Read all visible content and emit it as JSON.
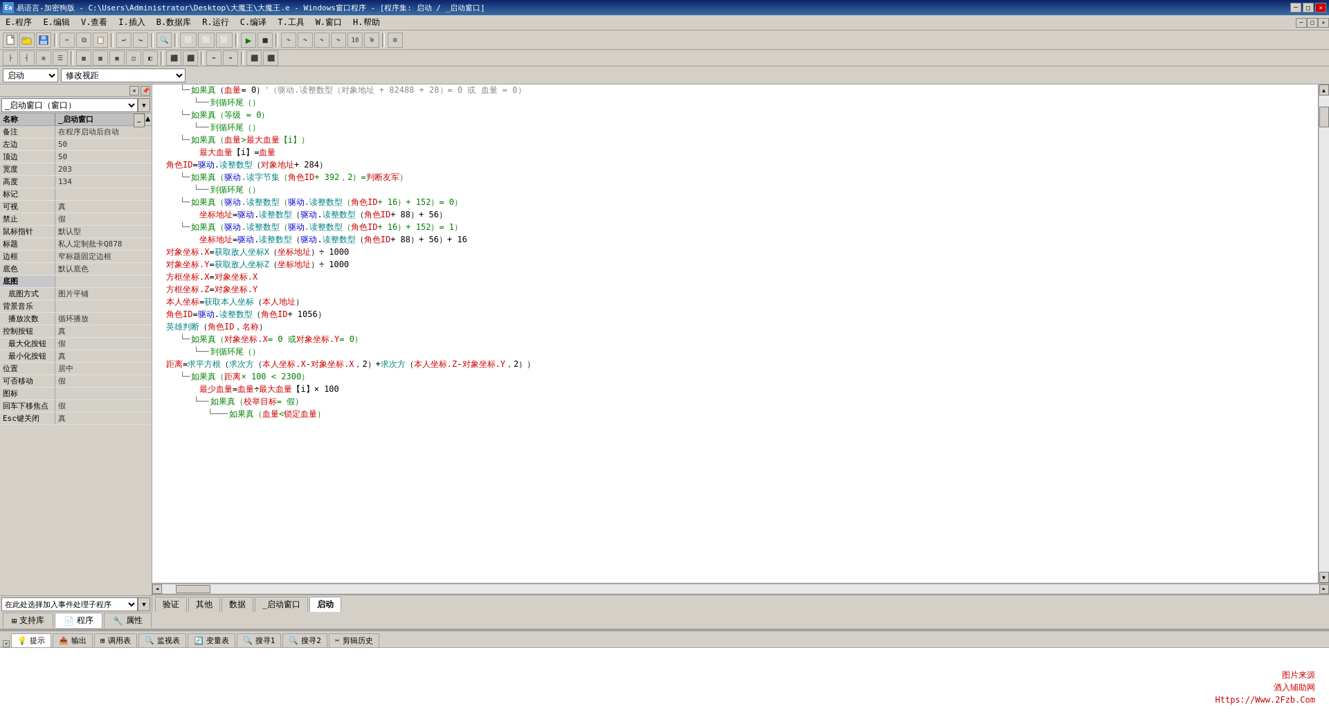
{
  "titlebar": {
    "title": "易语言-加密狗版 - C:\\Users\\Administrator\\Desktop\\大魔王\\大魔王.e - Windows窗口程序 - [程序集: 启动 / _启动窗口]",
    "min_btn": "─",
    "restore_btn": "□",
    "close_btn": "✕"
  },
  "menubar": {
    "items": [
      "E.程序",
      "E.编辑",
      "V.查看",
      "I.插入",
      "B.数据库",
      "R.运行",
      "C.编译",
      "T.工具",
      "W.窗口",
      "H.帮助"
    ]
  },
  "toolbar2": {
    "items": [
      "⬜",
      "⬜",
      "⬜",
      "⬜",
      "⬜",
      "⬜",
      "⬜",
      "⬜",
      "⬜",
      "⬜",
      "⬜",
      "⬜",
      "⬜",
      "⬜",
      "⬜",
      "⬜",
      "⬜",
      "⬜",
      "⬜",
      "⬜"
    ]
  },
  "addrbar": {
    "startup_label": "启动",
    "view_label": "修改视距"
  },
  "leftpanel": {
    "window_name": "_启动窗口（窗口）",
    "properties": [
      {
        "key": "名称",
        "val": "_启动窗口",
        "selected": true
      },
      {
        "key": "备注",
        "val": "在程序启动后自动"
      },
      {
        "key": "左边",
        "val": "50"
      },
      {
        "key": "顶边",
        "val": "50"
      },
      {
        "key": "宽度",
        "val": "203"
      },
      {
        "key": "高度",
        "val": "134"
      },
      {
        "key": "标记",
        "val": ""
      },
      {
        "key": "可视",
        "val": "真"
      },
      {
        "key": "禁止",
        "val": "假"
      },
      {
        "key": "鼠标指针",
        "val": "默认型"
      },
      {
        "key": "标题",
        "val": "私人定制批卡Q878"
      },
      {
        "key": "边框",
        "val": "窄标题固定边框"
      },
      {
        "key": "底色",
        "val": "默认底色"
      },
      {
        "key": "底图",
        "val": "",
        "group": true
      },
      {
        "key": "底图方式",
        "val": "图片平铺",
        "indent": true
      },
      {
        "key": "背景音乐",
        "val": ""
      },
      {
        "key": "播放次数",
        "val": "循环播放",
        "indent": true
      },
      {
        "key": "控制按钮",
        "val": "真"
      },
      {
        "key": "最大化按钮",
        "val": "假",
        "indent": true
      },
      {
        "key": "最小化按钮",
        "val": "真",
        "indent": true
      },
      {
        "key": "位置",
        "val": "居中"
      },
      {
        "key": "可否移动",
        "val": "假"
      },
      {
        "key": "图标",
        "val": ""
      },
      {
        "key": "回车下移焦点",
        "val": "假"
      },
      {
        "key": "Esc键关闭",
        "val": "真"
      }
    ],
    "event_placeholder": "在此处选择加入事件处理子程序"
  },
  "main_tabs": {
    "items": [
      "验证",
      "其他",
      "数据",
      "_启动窗口",
      "启动"
    ],
    "active": "启动"
  },
  "bottom_main_tabs": {
    "items": [
      "支持库",
      "程序",
      "属性"
    ],
    "active": "属性"
  },
  "code": {
    "lines": [
      {
        "indent": 2,
        "text": "如果真（血量 = 0）'（驱动.读整数型（对象地址 + 82488 + 28）= 0 或 血量 = 0）",
        "color": "mixed"
      },
      {
        "indent": 3,
        "text": "到循环尾（）",
        "color": "green"
      },
      {
        "indent": 2,
        "text": "如果真（等级 = 0）",
        "color": "green"
      },
      {
        "indent": 3,
        "text": "到循环尾（）",
        "color": "green"
      },
      {
        "indent": 2,
        "text": "如果真（血量 > 最大血量【i】）",
        "color": "green"
      },
      {
        "indent": 3,
        "text": "最大血量【i】= 血量",
        "color": "black"
      },
      {
        "indent": 1,
        "text": "角色ID = 驱动.读整数型（对象地址 + 284）",
        "color": "black"
      },
      {
        "indent": 2,
        "text": "如果真（驱动.读字节集（角色ID + 392，2）= 判断友军）",
        "color": "green"
      },
      {
        "indent": 3,
        "text": "到循环尾（）",
        "color": "green"
      },
      {
        "indent": 2,
        "text": "如果真（驱动.读整数型（驱动.读整数型（角色ID + 16）+ 152）= 0）",
        "color": "green"
      },
      {
        "indent": 3,
        "text": "坐标地址 = 驱动.读整数型（驱动.读整数型（角色ID + 88）+ 56）",
        "color": "black"
      },
      {
        "indent": 2,
        "text": "如果真（驱动.读整数型（驱动.读整数型（角色ID + 16）+ 152）= 1）",
        "color": "green"
      },
      {
        "indent": 3,
        "text": "坐标地址 = 驱动.读整数型（驱动.读整数型（角色ID + 88）+ 56）+ 16",
        "color": "black"
      },
      {
        "indent": 1,
        "text": "对象坐标.X = 获取敌人坐标X（坐标地址）÷ 1000",
        "color": "black"
      },
      {
        "indent": 1,
        "text": "对象坐标.Y = 获取敌人坐标Z（坐标地址）÷ 1000",
        "color": "black"
      },
      {
        "indent": 1,
        "text": "方框坐标.X = 对象坐标.X",
        "color": "black"
      },
      {
        "indent": 1,
        "text": "方框坐标.Z = 对象坐标.Y",
        "color": "black"
      },
      {
        "indent": 1,
        "text": "本人坐标 = 获取本人坐标（本人地址）",
        "color": "black"
      },
      {
        "indent": 1,
        "text": "角色ID = 驱动.读整数型（角色ID + 1056）",
        "color": "black"
      },
      {
        "indent": 1,
        "text": "英雄判断（角色ID，名称）",
        "color": "black"
      },
      {
        "indent": 2,
        "text": "如果真（对象坐标.X = 0 或 对象坐标.Y = 0）",
        "color": "green"
      },
      {
        "indent": 3,
        "text": "到循环尾（）",
        "color": "green"
      },
      {
        "indent": 1,
        "text": "距离 = 求平方根（求次方（本人坐标.X - 对象坐标.X，2）+ 求次方（本人坐标.Z - 对象坐标.Y，2））",
        "color": "black"
      },
      {
        "indent": 2,
        "text": "如果真（距离 × 100 < 2300）",
        "color": "green"
      },
      {
        "indent": 3,
        "text": "最少血量 = 血量 ÷ 最大血量【i】× 100",
        "color": "black"
      },
      {
        "indent": 3,
        "text": "如果真（校举目标 = 假）",
        "color": "green"
      },
      {
        "indent": 4,
        "text": "如果真（血量 < 锁定血量）",
        "color": "green"
      }
    ]
  },
  "bottom_panel": {
    "tabs": [
      {
        "label": "💡 提示",
        "icon": "hint"
      },
      {
        "label": "📤 输出",
        "icon": "output"
      },
      {
        "label": "⊞ 调用表",
        "icon": "calltable"
      },
      {
        "label": "🔍 监视表",
        "icon": "watch"
      },
      {
        "label": "🔄 变量表",
        "icon": "vars"
      },
      {
        "label": "🔍 搜寻1",
        "icon": "search1"
      },
      {
        "label": "🔍 搜寻2",
        "icon": "search2"
      },
      {
        "label": "✂ 剪辑历史",
        "icon": "cliphistory"
      }
    ],
    "active": "提示",
    "watermark": {
      "line1": "图片来源",
      "line2": "酒入辅助网",
      "line3": "Https://Www.2Fzb.Com"
    }
  }
}
